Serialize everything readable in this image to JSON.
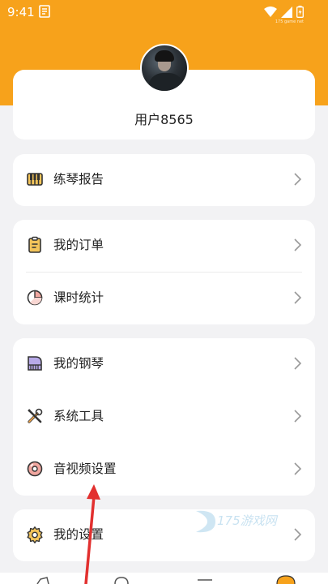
{
  "status": {
    "time": "9:41",
    "corner_watermark": "175 game net"
  },
  "profile": {
    "username": "用户8565"
  },
  "menu": {
    "practice_report": "练琴报告",
    "my_orders": "我的订单",
    "lesson_stats": "课时统计",
    "my_piano": "我的钢琴",
    "system_tools": "系统工具",
    "av_settings": "音视频设置",
    "my_settings": "我的设置"
  },
  "watermark": {
    "text": "175游戏网"
  },
  "colors": {
    "accent": "#f7a21b",
    "background": "#f2f2f4",
    "annotation_arrow": "#e2302f"
  },
  "icons": {
    "practice_report": "piano-keys-icon",
    "my_orders": "clipboard-icon",
    "lesson_stats": "pie-chart-icon",
    "my_piano": "grand-piano-icon",
    "system_tools": "tools-icon",
    "av_settings": "av-disc-icon",
    "my_settings": "gear-icon"
  }
}
